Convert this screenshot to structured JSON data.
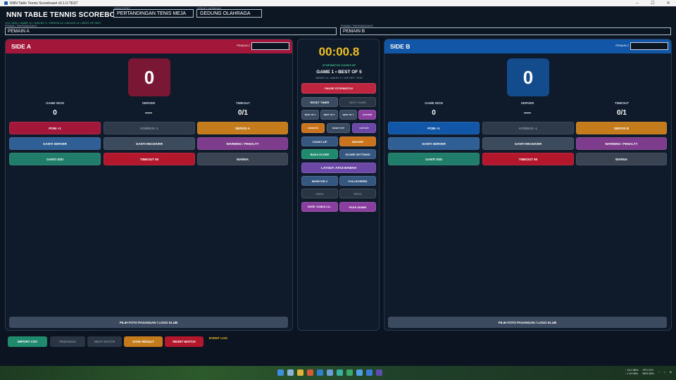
{
  "window": {
    "title": "NNN Table Tennis Scoreboard v0.1.0-TEST"
  },
  "header": {
    "app_title": "NNN TABLE TENNIS SCOREBOARD",
    "subtitle": "1/11 2026 • GAME 11 • WIN BY 2 • SERVIS x2 • DEUCE x1 • BEST OF 3/5/7",
    "event_label": "NAMA EVENT",
    "event_value": "PERTANDINGAN TENIS MEJA",
    "venue_label": "VENUE / LAPANGAN",
    "venue_value": "GEDUNG OLAHRAGA",
    "player_a_label": "PEMAIN / TIM/PASANGAN A",
    "player_a_value": "PEMAIN A",
    "player_b_label": "PEMAIN / TIM/PASANGAN B",
    "player_b_value": "PEMAIN B"
  },
  "side_a": {
    "name": "SIDE A",
    "partner_label": "PEMAIN 2",
    "score": "0",
    "game_won_label": "GAME WON",
    "game_won_value": "0",
    "server_label": "SERVER",
    "server_value": "—",
    "timeout_label": "TIMEOUT",
    "timeout_value": "0/1",
    "btn_point": "POIN +1",
    "btn_correct": "KOREKSI -1",
    "btn_serve": "SERVIS A",
    "btn_change_server": "GANTI SERVER",
    "btn_change_receiver": "GANTI RECEIVER",
    "btn_warning": "WARNING / PENALTY",
    "btn_change_side": "GANTI SISI",
    "btn_timeout": "TIMEOUT 60",
    "btn_color": "WARNA",
    "btn_photo": "PILIH FOTO PASANGAN / LOGO KLUB"
  },
  "side_b": {
    "name": "SIDE B",
    "partner_label": "PEMAIN 2",
    "score": "0",
    "game_won_label": "GAME WON",
    "game_won_value": "0",
    "server_label": "SERVER",
    "server_value": "—",
    "timeout_label": "TIMEOUT",
    "timeout_value": "0/1",
    "btn_point": "POIN +1",
    "btn_correct": "KOREKSI -1",
    "btn_serve": "SERVIS B",
    "btn_change_server": "GANTI SERVER",
    "btn_change_receiver": "GANTI RECEIVER",
    "btn_warning": "WARNING / PENALTY",
    "btn_change_side": "GANTI SISI",
    "btn_timeout": "TIMEOUT 60",
    "btn_color": "WARNA",
    "btn_photo": "PILIH FOTO PASANGAN / LOGO KLUB"
  },
  "center": {
    "timer": "00:00.8",
    "timer_mode": "STOPWATCH COUNT-UP",
    "game_line": "GAME 1 • BEST OF 5",
    "game_sub": "TARGET 11 • WIN BY 2 • CAP OFF • TEST",
    "btn_pause": "PAUSE STOPWATCH",
    "btn_reset_timer": "RESET TIMER",
    "btn_next_game": "NEXT GAME",
    "btn_bo3": "BEST OF 3",
    "btn_bo5": "BEST OF 5",
    "btn_bo7": "BEST OF 7",
    "btn_custom": "CUSTOM",
    "btn_expedite": "EXPEDITE",
    "btn_reset_stp": "RESET STP",
    "btn_cap": "CAP OFF",
    "btn_count_up": "COUNT-UP",
    "btn_bigger": "BIGGER",
    "btn_score_open": "BUKA SCORE",
    "btn_score_settings": "SCORE SETTINGS",
    "btn_layout": "LAYOUT: ATAS-BAWAH",
    "btn_monitor": "MONITOR 2",
    "btn_fullscreen": "FULLSCREEN",
    "btn_undo": "UNDO",
    "btn_redo": "REDO",
    "btn_mode": "MODE: GANDA CA...",
    "btn_admin": "PASS ADMIN"
  },
  "footer": {
    "btn_import": "IMPORT CSV",
    "btn_previous": "PREVIOUS",
    "btn_next_match": "NEXT MATCH",
    "btn_save": "SAVE RESULT",
    "btn_reset": "RESET MATCH",
    "event_log": "EVENT LOG"
  },
  "taskbar": {
    "net_up": "↑ 15.1 MB/s",
    "net_down": "↓ 1.20 KB/s",
    "cpu": "CPU 11%",
    "mem": "MEM 36%"
  },
  "colors": {
    "side_a_accent": "#a3183a",
    "side_b_accent": "#1256a8",
    "timer": "#f0c020",
    "background": "#0b1420"
  }
}
